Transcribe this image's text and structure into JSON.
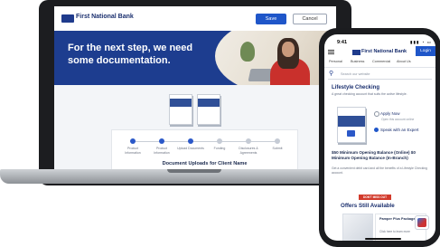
{
  "laptop": {
    "brand": "First National Bank",
    "save_label": "Save",
    "cancel_label": "Cancel",
    "hero_title": "For the next step, we need some documentation.",
    "steps": [
      {
        "label": "Product Information",
        "done": true
      },
      {
        "label": "Product Information",
        "done": true
      },
      {
        "label": "Upload Documents",
        "done": true
      },
      {
        "label": "Funding",
        "done": false
      },
      {
        "label": "Disclosures & Agreements",
        "done": false
      },
      {
        "label": "Submit",
        "done": false
      }
    ],
    "upload_title": "Document Uploads for Client Name"
  },
  "phone": {
    "time": "9:41",
    "brand": "First National Bank",
    "login_label": "Login",
    "nav": [
      "Personal",
      "Business",
      "Commercial",
      "About Us"
    ],
    "search_placeholder": "Search our website",
    "product_title": "Lifestyle Checking",
    "product_desc": "A great checking account that suits the active lifestyle.",
    "apply_label": "Apply Now",
    "apply_sub": "Open this account online",
    "speak_label": "Speak with an Expert",
    "min_text": "$50 Minimum Opening Balance (Online) $0 Minimum Opening Balance (In-Branch)",
    "min_sub": "Get a convenient debit card and all the benefits of a Lifestyle Checking account.",
    "badge": "DON'T MISS OUT",
    "offers_title": "Offers Still Available",
    "offer_name": "Pamper Plus Package",
    "offer_sub": "Click here to learn more"
  }
}
